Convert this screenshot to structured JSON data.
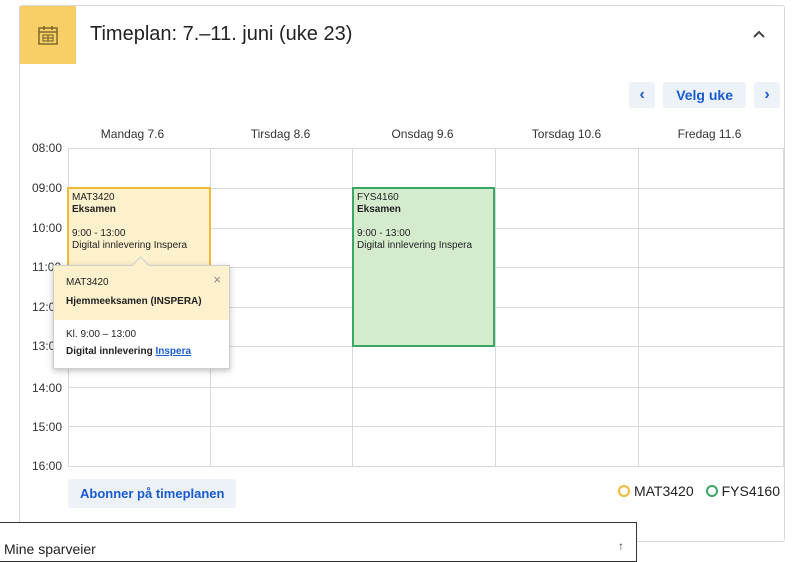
{
  "header": {
    "title": "Timeplan: 7.–11. juni (uke 23)",
    "icon": "calendar-icon",
    "collapse_icon": "chevron-up-icon"
  },
  "week_nav": {
    "prev": "‹",
    "label": "Velg uke",
    "next": "›"
  },
  "days": [
    "Mandag 7.6",
    "Tirsdag 8.6",
    "Onsdag 9.6",
    "Torsdag 10.6",
    "Fredag 11.6"
  ],
  "times": [
    "08:00",
    "09:00",
    "10:00",
    "11:00",
    "12:00",
    "13:00",
    "14:00",
    "15:00",
    "16:00"
  ],
  "events": [
    {
      "code": "MAT3420",
      "type": "Eksamen",
      "time": "9:00 - 13:00",
      "location": "Digital innlevering Inspera",
      "color": "#f0b93a"
    },
    {
      "code": "FYS4160",
      "type": "Eksamen",
      "time": "9:00 - 13:00",
      "location": "Digital innlevering Inspera",
      "color": "#39a864"
    }
  ],
  "popup": {
    "code": "MAT3420",
    "title": "Hjemmeeksamen (INSPERA)",
    "time": "Kl. 9:00 – 13:00",
    "location_prefix": "Digital innlevering ",
    "location_link": "Inspera",
    "close": "×"
  },
  "subscribe_label": "Abonner på timeplanen",
  "legend": [
    {
      "label": "MAT3420",
      "color": "#f0b93a"
    },
    {
      "label": "FYS4160",
      "color": "#39a864"
    }
  ],
  "bottom_panel": {
    "title": "Mine sparveier",
    "arrow": "↑"
  },
  "colors": {
    "accent_yellow": "#f7cf66",
    "link_blue": "#1a5bd0",
    "button_bg": "#edf1f8"
  }
}
